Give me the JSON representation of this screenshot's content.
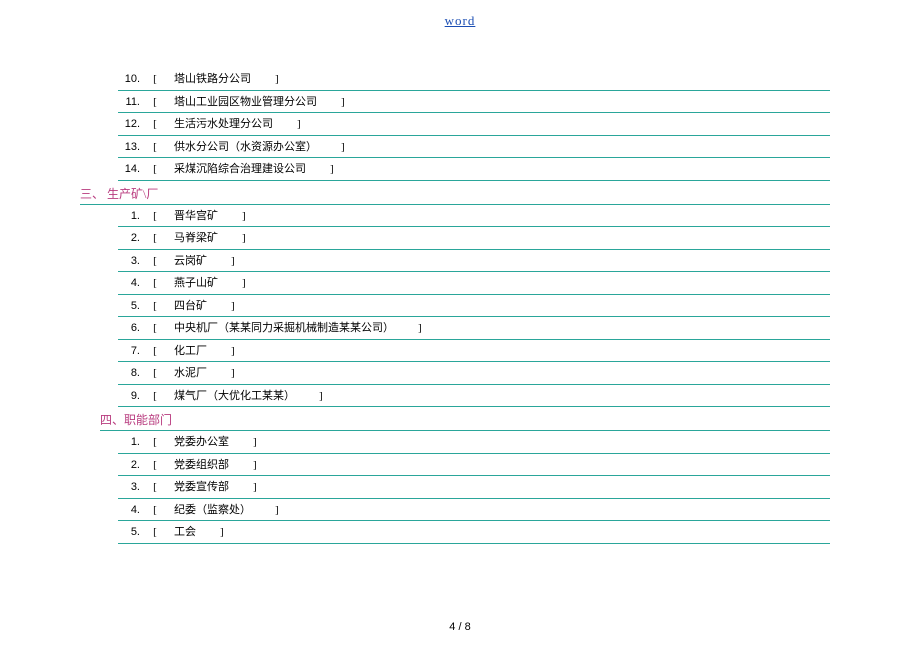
{
  "header_link": "word",
  "section_a_start": 10,
  "section_a_items": [
    "塔山铁路分公司",
    "塔山工业园区物业管理分公司",
    "生活污水处理分公司",
    "供水分公司（水资源办公室）",
    "采煤沉陷综合治理建设公司"
  ],
  "section_b_title": "三、 生产矿\\厂",
  "section_b_items": [
    "晋华宫矿",
    "马脊梁矿",
    "云岗矿",
    "燕子山矿",
    "四台矿",
    "中央机厂（某某同力采掘机械制造某某公司）",
    "化工厂",
    "水泥厂",
    "煤气厂（大优化工某某）"
  ],
  "section_c_title": "四、职能部门",
  "section_c_items": [
    "党委办公室",
    "党委组织部",
    "党委宣传部",
    "纪委（监察处）",
    "工会"
  ],
  "page_current": "4",
  "page_total": "8",
  "page_sep": " / "
}
